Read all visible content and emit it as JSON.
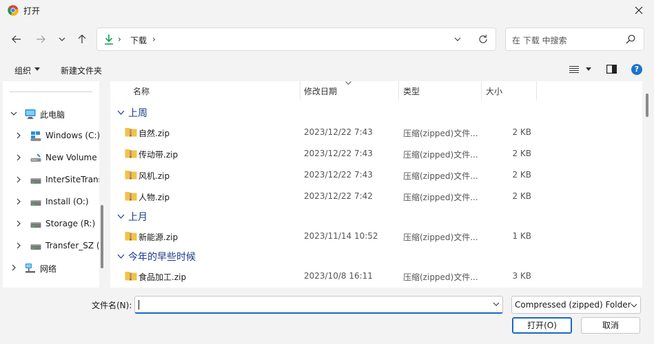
{
  "window": {
    "title": "打开"
  },
  "address": {
    "crumb": "下载",
    "chevron": "›"
  },
  "search": {
    "placeholder": "在 下载 中搜索"
  },
  "toolbar": {
    "organize": "组织",
    "new_folder": "新建文件夹",
    "help": "?"
  },
  "sidebar": {
    "items": [
      {
        "label": "此电脑",
        "icon": "pc-icon",
        "level": 0,
        "expanded": true
      },
      {
        "label": "Windows (C:)",
        "icon": "windows-drive-icon",
        "level": 1
      },
      {
        "label": "New Volume (D:)",
        "icon": "network-drive-icon",
        "level": 1
      },
      {
        "label": "InterSiteTransfer (",
        "icon": "drive-icon",
        "level": 1
      },
      {
        "label": "Install (O:)",
        "icon": "drive-icon",
        "level": 1
      },
      {
        "label": "Storage (R:)",
        "icon": "drive-icon",
        "level": 1
      },
      {
        "label": "Transfer_SZ (",
        "icon": "drive-icon",
        "level": 1
      },
      {
        "label": "网络",
        "icon": "network-icon",
        "level": 0,
        "expanded": false
      }
    ]
  },
  "columns": {
    "name": "名称",
    "date": "修改日期",
    "type": "类型",
    "size": "大小"
  },
  "groups": [
    {
      "label": "上周",
      "files": [
        {
          "name": "自然.zip",
          "date": "2023/12/22 7:43",
          "type": "压缩(zipped)文件...",
          "size": "2 KB"
        },
        {
          "name": "传动带.zip",
          "date": "2023/12/22 7:43",
          "type": "压缩(zipped)文件...",
          "size": "2 KB"
        },
        {
          "name": "风机.zip",
          "date": "2023/12/22 7:43",
          "type": "压缩(zipped)文件...",
          "size": "2 KB"
        },
        {
          "name": "人物.zip",
          "date": "2023/12/22 7:42",
          "type": "压缩(zipped)文件...",
          "size": "2 KB"
        }
      ]
    },
    {
      "label": "上月",
      "files": [
        {
          "name": "新能源.zip",
          "date": "2023/11/14 10:52",
          "type": "压缩(zipped)文件...",
          "size": "1 KB"
        }
      ]
    },
    {
      "label": "今年的早些时候",
      "files": [
        {
          "name": "食品加工.zip",
          "date": "2023/10/8 16:11",
          "type": "压缩(zipped)文件...",
          "size": "3 KB"
        }
      ]
    }
  ],
  "bottom": {
    "filename_label": "文件名(N):",
    "filename_value": "",
    "filetype": "Compressed (zipped) Folder",
    "open_label": "打开(O)",
    "cancel_label": "取消"
  },
  "colors": {
    "accent": "#1a67c2",
    "group_label": "#1a3a8f",
    "folder": "#f3c24a",
    "download": "#17a34a"
  }
}
